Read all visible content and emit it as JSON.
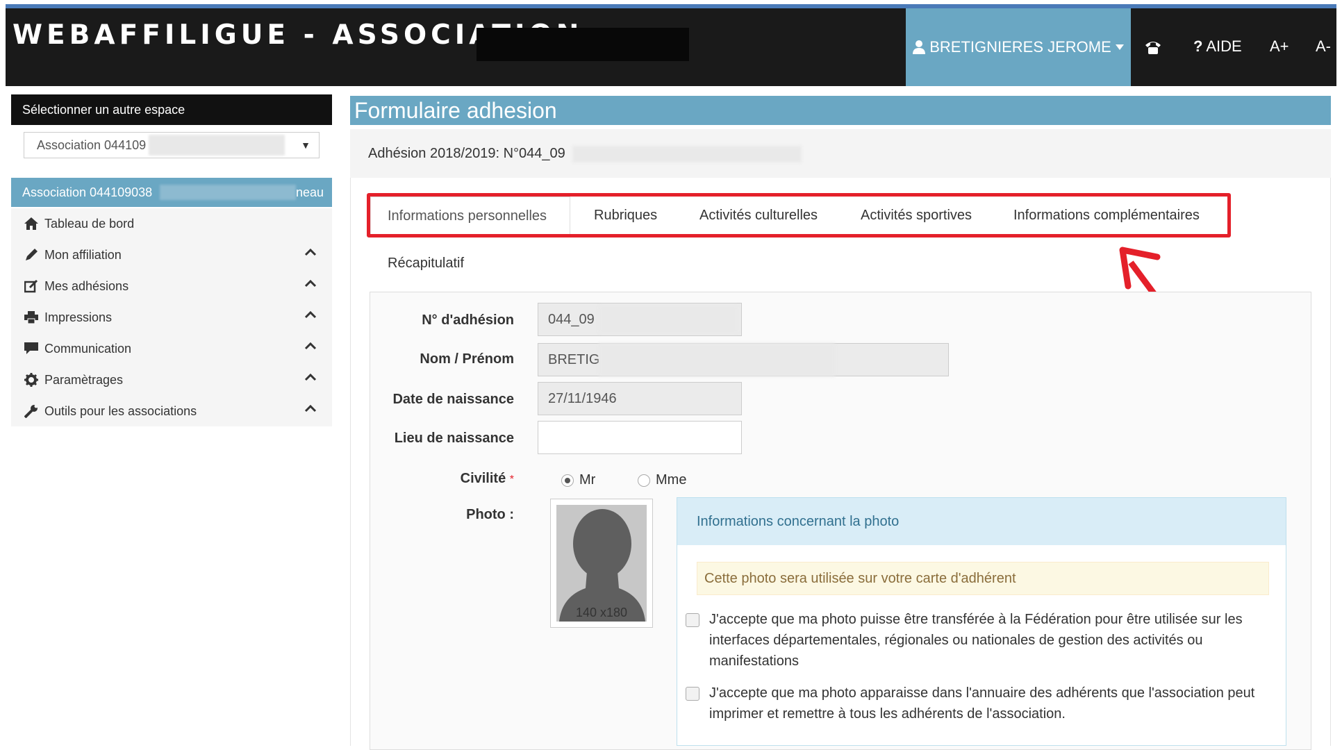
{
  "header": {
    "brand": "WEBAFFILIGUE - ASSOCIATION",
    "user": "BRETIGNIERES JEROME",
    "help": "AIDE",
    "font_plus": "A+",
    "font_minus": "A-",
    "accent_color": "#6aa7c3"
  },
  "sidebar": {
    "select_space_title": "Sélectionner un autre espace",
    "space_select_value": "Association 044109",
    "current_association": "Association 044109038",
    "current_association_suffix": "neau",
    "items": [
      {
        "label": "Tableau de bord",
        "icon": "home-icon"
      },
      {
        "label": "Mon affiliation",
        "icon": "pencil-icon"
      },
      {
        "label": "Mes adhésions",
        "icon": "edit-icon"
      },
      {
        "label": "Impressions",
        "icon": "print-icon"
      },
      {
        "label": "Communication",
        "icon": "comment-icon"
      },
      {
        "label": "Paramètrages",
        "icon": "gear-icon"
      },
      {
        "label": "Outils pour les associations",
        "icon": "wrench-icon"
      }
    ]
  },
  "main": {
    "title": "Formulaire adhesion",
    "subtitle": "Adhésion 2018/2019: N°044_09",
    "tabs": [
      "Informations personnelles",
      "Rubriques",
      "Activités culturelles",
      "Activités sportives",
      "Informations complémentaires"
    ],
    "recap_tab": "Récapitulatif",
    "form": {
      "adhesion_label": "N° d'adhésion",
      "adhesion_value": "044_09",
      "name_label": "Nom / Prénom",
      "name_value": "BRETIG",
      "birthdate_label": "Date de naissance",
      "birthdate_value": "27/11/1946",
      "birthplace_label": "Lieu de naissance",
      "birthplace_value": "",
      "civility_label": "Civilité",
      "civility_required": "*",
      "civility_options": [
        "Mr",
        "Mme"
      ],
      "civility_selected": "Mr",
      "photo_label": "Photo :",
      "photo_size": "140 x180"
    },
    "photo_info": {
      "title": "Informations concernant la photo",
      "warning": "Cette photo sera utilisée sur votre carte d'adhérent",
      "consent_1": "J'accepte que ma photo puisse être transférée à la Fédération pour être utilisée sur les interfaces départementales, régionales ou nationales de gestion des activités ou manifestations",
      "consent_2": "J'accepte que ma photo apparaisse dans l'annuaire des adhérents que l'association peut imprimer et remettre à tous les adhérents de l'association."
    }
  }
}
